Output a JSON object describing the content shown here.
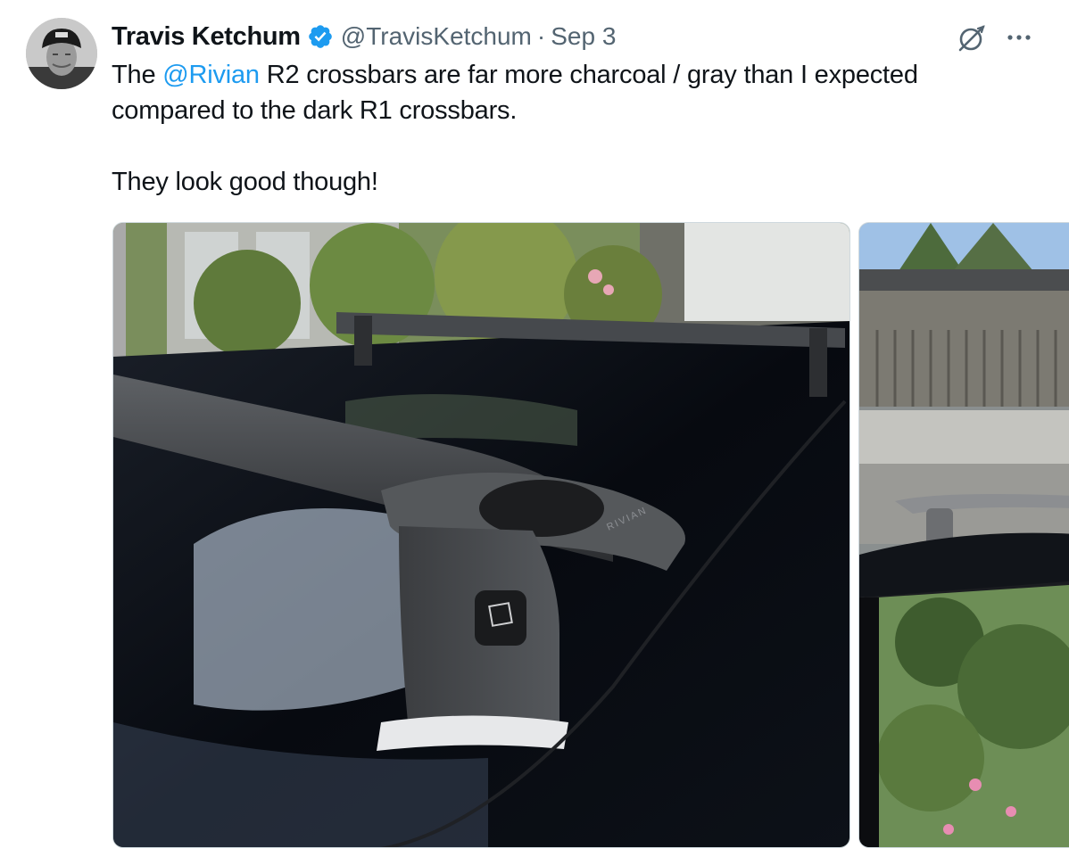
{
  "author": {
    "display_name": "Travis Ketchum",
    "handle": "@TravisKetchum",
    "verified": true,
    "avatar_icon": "profile-photo"
  },
  "meta": {
    "separator": "·",
    "date": "Sep 3"
  },
  "actions": {
    "grok_icon": "grok-icon",
    "more_label": "···"
  },
  "text": {
    "line1_pre": "The ",
    "mention": "@Rivian",
    "line1_post": " R2 crossbars are far more charcoal / gray than I expected compared to the dark R1 crossbars.",
    "line2": "They look good though!"
  },
  "media": {
    "count": 2,
    "photo1_alt": "",
    "photo2_alt": "",
    "photo1_logo_text": "RIVIAN"
  },
  "colors": {
    "link": "#1d9bf0",
    "verified": "#1d9bf0",
    "secondary_text": "#536471"
  }
}
